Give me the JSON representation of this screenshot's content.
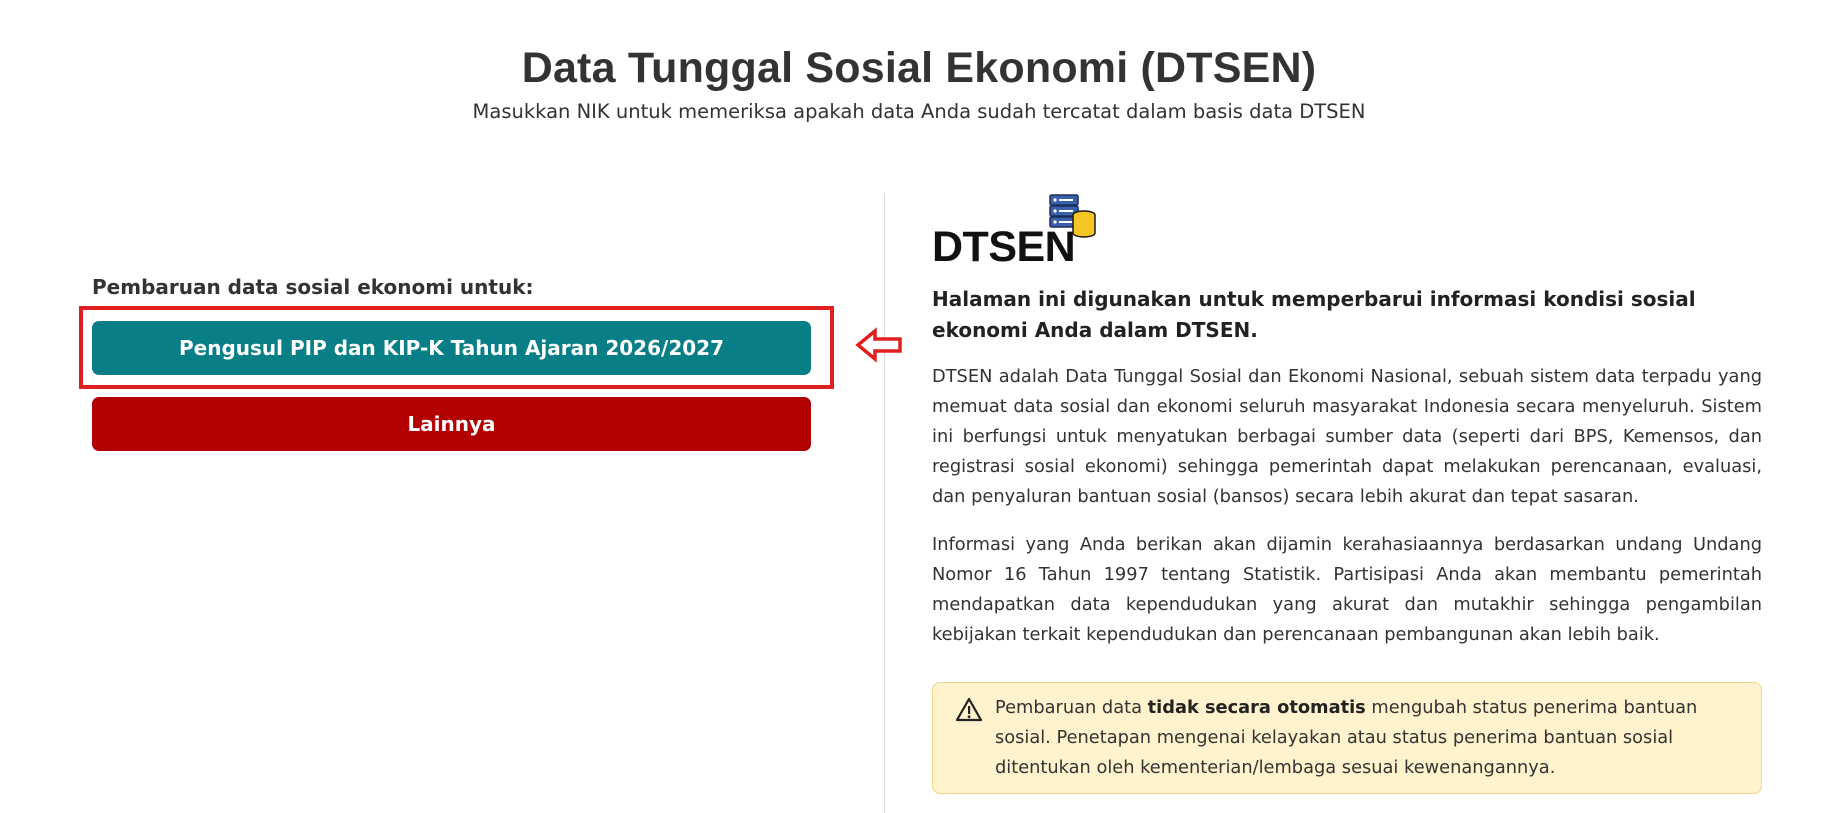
{
  "header": {
    "title": "Data Tunggal Sosial Ekonomi (DTSEN)",
    "subtitle": "Masukkan NIK untuk memeriksa apakah data Anda sudah tercatat dalam basis data DTSEN"
  },
  "left": {
    "heading": "Pembaruan data sosial ekonomi untuk:",
    "buttons": [
      {
        "label": "Pengusul PIP dan KIP-K Tahun Ajaran 2026/2027",
        "color": "#087f87"
      },
      {
        "label": "Lainnya",
        "color": "#b30000"
      }
    ],
    "highlight_color": "#e02020"
  },
  "right": {
    "logo_text": "DTSEN",
    "intro": "Halaman ini digunakan untuk memperbarui informasi kondisi sosial ekonomi Anda dalam DTSEN.",
    "paragraphs": [
      "DTSEN adalah Data Tunggal Sosial dan Ekonomi Nasional, sebuah sistem data terpadu yang memuat data sosial dan ekonomi seluruh masyarakat Indonesia secara menyeluruh. Sistem ini berfungsi untuk menyatukan berbagai sumber data (seperti dari BPS, Kemensos, dan registrasi sosial ekonomi) sehingga pemerintah dapat melakukan perencanaan, evaluasi, dan penyaluran bantuan sosial (bansos) secara lebih akurat dan tepat sasaran.",
      "Informasi yang Anda berikan akan dijamin kerahasiaannya berdasarkan undang Undang Nomor 16 Tahun 1997 tentang Statistik. Partisipasi Anda akan membantu pemerintah mendapatkan data kependudukan yang akurat dan mutakhir sehingga pengambilan kebijakan terkait kependudukan dan perencanaan pembangunan akan lebih baik."
    ],
    "alert": {
      "icon": "warning-icon",
      "prefix": "Pembaruan data ",
      "bold": "tidak secara otomatis",
      "suffix": " mengubah status penerima bantuan sosial. Penetapan mengenai kelayakan atau status penerima bantuan sosial ditentukan oleh kementerian/lembaga sesuai kewenangannya."
    }
  }
}
